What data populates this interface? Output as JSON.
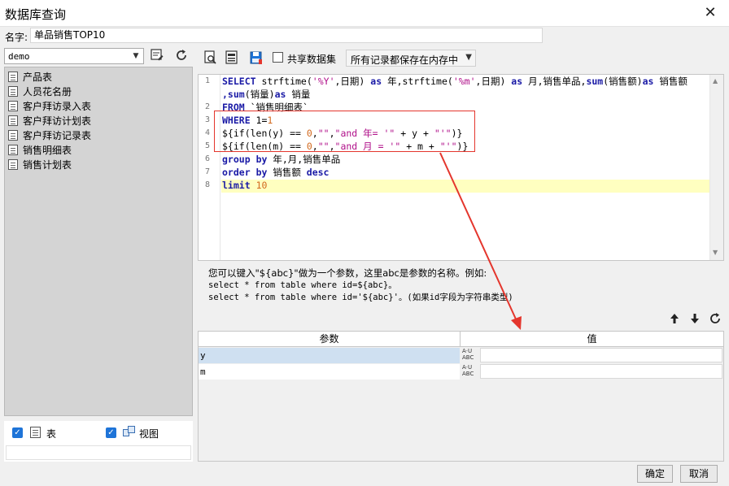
{
  "window": {
    "title": "数据库查询",
    "close_glyph": "✕"
  },
  "name_row": {
    "label": "名字:",
    "value": "单品销售TOP10"
  },
  "left_panel": {
    "database": "demo",
    "tables": [
      "产品表",
      "人员花名册",
      "客户拜访录入表",
      "客户拜访计划表",
      "客户拜访记录表",
      "销售明细表",
      "销售计划表"
    ],
    "show_tables_label": "表",
    "show_views_label": "视图"
  },
  "toolbar": {
    "share_label": "共享数据集",
    "memory_option": "所有记录都保存在内存中"
  },
  "editor": {
    "line_numbers": [
      "1",
      "2",
      "3",
      "4",
      "5",
      "6",
      "7",
      "8"
    ],
    "lines": {
      "l1_kw1": "SELECT",
      "l1_a": " strftime(",
      "l1_s1": "'%Y'",
      "l1_b": ",日期) ",
      "l1_kw2": "as",
      "l1_c": " 年,strftime(",
      "l1_s2": "'%m'",
      "l1_d": ",日期) ",
      "l1_kw3": "as",
      "l1_e": " 月,销售单品,",
      "l1_kw4": "sum",
      "l1_f": "(销售额)",
      "l1_kw5": "as",
      "l1_g": " 销售额",
      "l1w_kw1": ",sum",
      "l1w_a": "(销量)",
      "l1w_kw2": "as",
      "l1w_b": " 销量",
      "l2_kw": "FROM",
      "l2_a": " `销售明细表`",
      "l3_kw": "WHERE",
      "l3_a": " 1=",
      "l3_n": "1",
      "l4_a": "${if(len(y) == ",
      "l4_n": "0",
      "l4_b": ",",
      "l4_s1": "\"\"",
      "l4_c": ",",
      "l4_s2": "\"and 年= '\"",
      "l4_d": " + y + ",
      "l4_s3": "\"'\"",
      "l4_e": ")}",
      "l5_a": "${if(len(m) == ",
      "l5_n": "0",
      "l5_b": ",",
      "l5_s1": "\"\"",
      "l5_c": ",",
      "l5_s2": "\"and 月 = '\"",
      "l5_d": " + m + ",
      "l5_s3": "\"'\"",
      "l5_e": ")}",
      "l6_kw1": "group",
      "l6_sp": " ",
      "l6_kw2": "by",
      "l6_a": " 年,月,销售单品",
      "l7_kw1": "order",
      "l7_sp": " ",
      "l7_kw2": "by",
      "l7_a": " 销售额 ",
      "l7_kw3": "desc",
      "l8_kw": "limit",
      "l8_sp": " ",
      "l8_n": "10"
    }
  },
  "hint": {
    "line1": "您可以键入\"${abc}\"做为一个参数，这里abc是参数的名称。例如:",
    "line2": "select * from table where id=${abc}。",
    "line3": "select * from table where id='${abc}'。(如果id字段为字符串类型)"
  },
  "params": {
    "header_name": "参数",
    "header_value": "值",
    "type_icon_text": "A·U ABC",
    "rows": [
      {
        "name": "y",
        "value": ""
      },
      {
        "name": "m",
        "value": ""
      }
    ]
  },
  "footer": {
    "ok": "确定",
    "cancel": "取消"
  },
  "colors": {
    "keyword": "#1a1aa6",
    "string": "#b0108a",
    "number": "#d2691e",
    "highlight": "#ffffc0",
    "annotation_red": "#e4362d",
    "checkbox": "#1e74d8"
  }
}
